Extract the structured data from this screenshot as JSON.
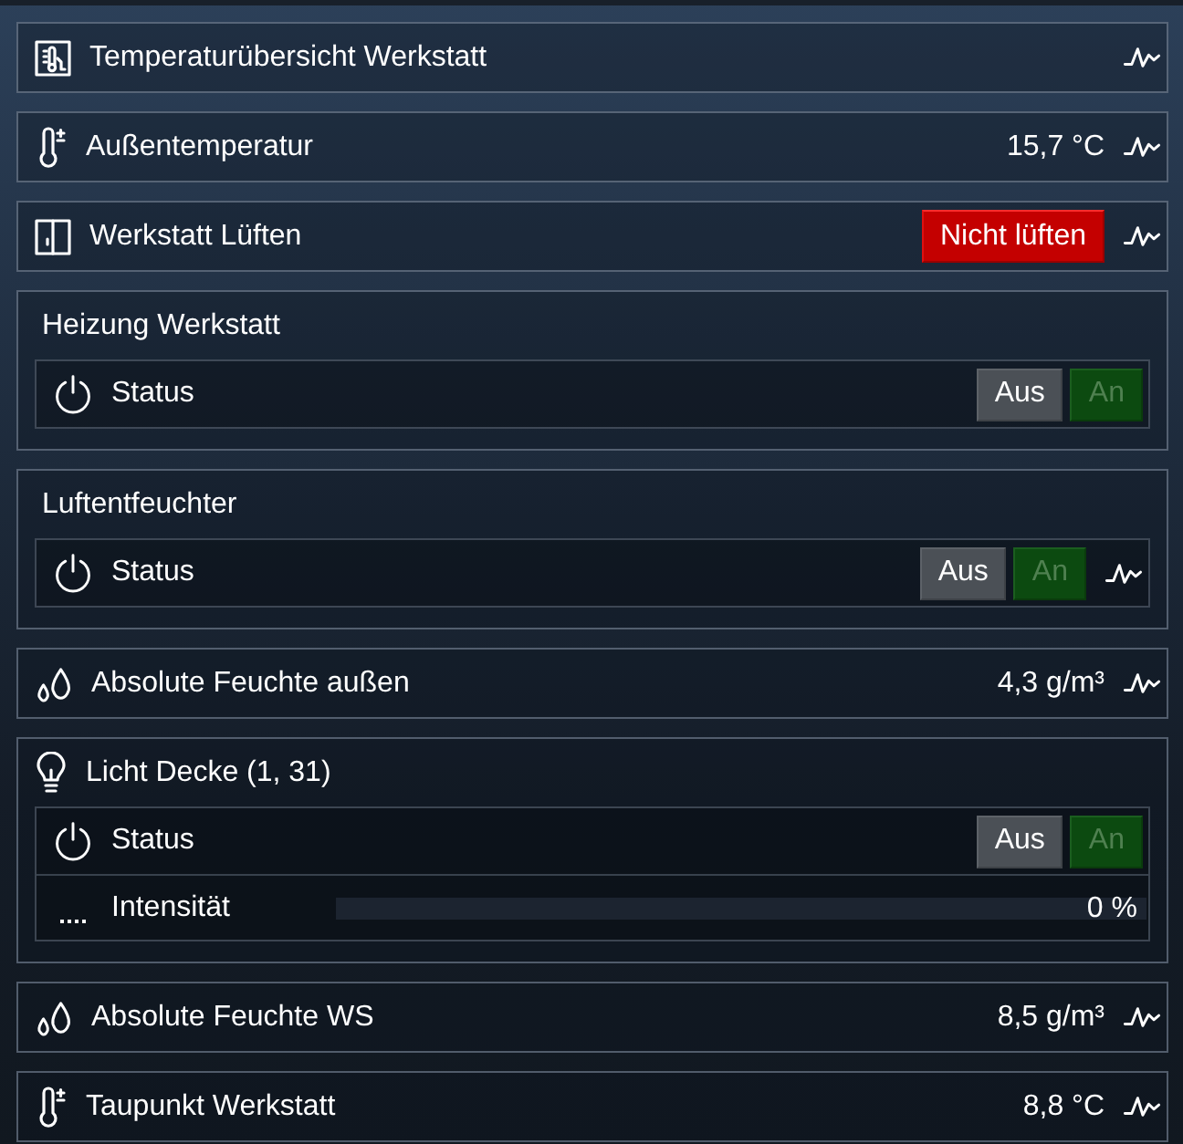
{
  "widgets": [
    {
      "kind": "overview",
      "label": "Temperaturübersicht Werkstatt",
      "history": true
    },
    {
      "kind": "temperature",
      "label": "Außentemperatur",
      "value": "15,7 °C",
      "history": true
    },
    {
      "kind": "window",
      "label": "Werkstatt Lüften",
      "buttons": [
        {
          "label": "Nicht lüften",
          "kind": "alert",
          "selected": true
        }
      ],
      "history": true
    },
    {
      "kind": "group",
      "label": "Heizung Werkstatt",
      "items": [
        {
          "kind": "switch",
          "label": "Status",
          "buttons": [
            {
              "label": "Aus",
              "kind": "off",
              "selected": true
            },
            {
              "label": "An",
              "kind": "on",
              "selected": false
            }
          ],
          "history": false
        }
      ]
    },
    {
      "kind": "group",
      "label": "Luftentfeuchter",
      "items": [
        {
          "kind": "switch",
          "label": "Status",
          "buttons": [
            {
              "label": "Aus",
              "kind": "off",
              "selected": true
            },
            {
              "label": "An",
              "kind": "on",
              "selected": false
            }
          ],
          "history": true
        }
      ]
    },
    {
      "kind": "humidity",
      "label": "Absolute Feuchte außen",
      "value": "4,3 g/m³",
      "history": true
    },
    {
      "kind": "lightgroup",
      "label": "Licht Decke (1, 31)",
      "items": [
        {
          "kind": "switch",
          "label": "Status",
          "buttons": [
            {
              "label": "Aus",
              "kind": "off",
              "selected": true
            },
            {
              "label": "An",
              "kind": "on",
              "selected": false
            }
          ],
          "history": false
        },
        {
          "kind": "dimmer",
          "label": "Intensität",
          "level": 0,
          "value": "0 %",
          "history": false
        }
      ]
    },
    {
      "kind": "humidity",
      "label": "Absolute Feuchte WS",
      "value": "8,5 g/m³",
      "history": true
    },
    {
      "kind": "temperature",
      "label": "Taupunkt Werkstatt",
      "value": "8,8 °C",
      "history": true
    }
  ]
}
